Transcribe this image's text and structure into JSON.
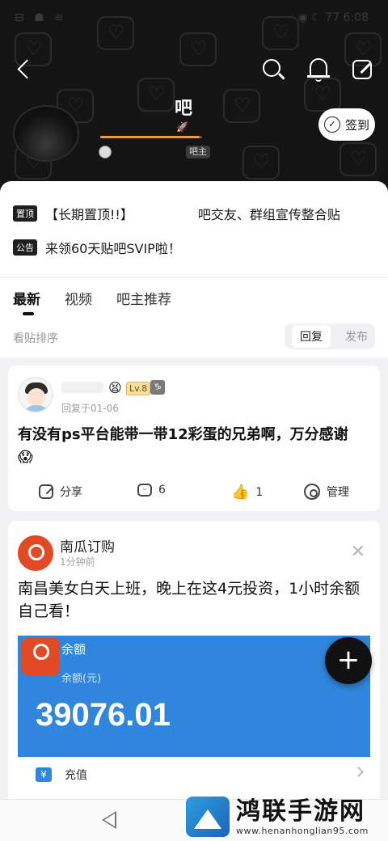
{
  "status_bar": {
    "left_icons": "⊟ ☗ ≋",
    "right_text": "◉ ☾ 77 6:08"
  },
  "header": {
    "bar_name": "吧",
    "rocket_icon": "🚀",
    "level_progress": 0.98,
    "owner_label": "吧主",
    "signin_label": "签到"
  },
  "notices": [
    {
      "tag": "置顶",
      "text": "【长期置顶!!】",
      "text2": "吧交友、群组宣传整合贴"
    },
    {
      "tag": "公告",
      "text": "来领60天贴吧SVIP啦！"
    }
  ],
  "tabs": [
    {
      "label": "最新",
      "active": true
    },
    {
      "label": "视频",
      "active": false
    },
    {
      "label": "吧主推荐",
      "active": false
    }
  ],
  "sort": {
    "label": "看贴排序",
    "options": [
      "回复",
      "发布"
    ],
    "selected": "回复"
  },
  "post1": {
    "emoji": "😫",
    "level": "Lv.8",
    "zodiac": "♑",
    "reply_time": "回复于01-06",
    "title": "有没有ps平台能带一带12彩蛋的兄弟啊，万分感谢",
    "title_emoji": "😱",
    "share_label": "分享",
    "comment_count": "6",
    "like_count": "1",
    "manage_label": "管理"
  },
  "ad": {
    "name": "南瓜订购",
    "time": "1分钟前",
    "close": "✕",
    "text": "南昌美女白天上班，晚上在这4元投资，1小时余额自己看！",
    "image_title": "余额",
    "image_sub": "余额(元)",
    "balance": "39076.01",
    "row_label": "充值",
    "yen": "¥"
  },
  "fab_label": "+",
  "watermark": {
    "title": "鸿联手游网",
    "url": "www.henanhonglian95.com"
  }
}
